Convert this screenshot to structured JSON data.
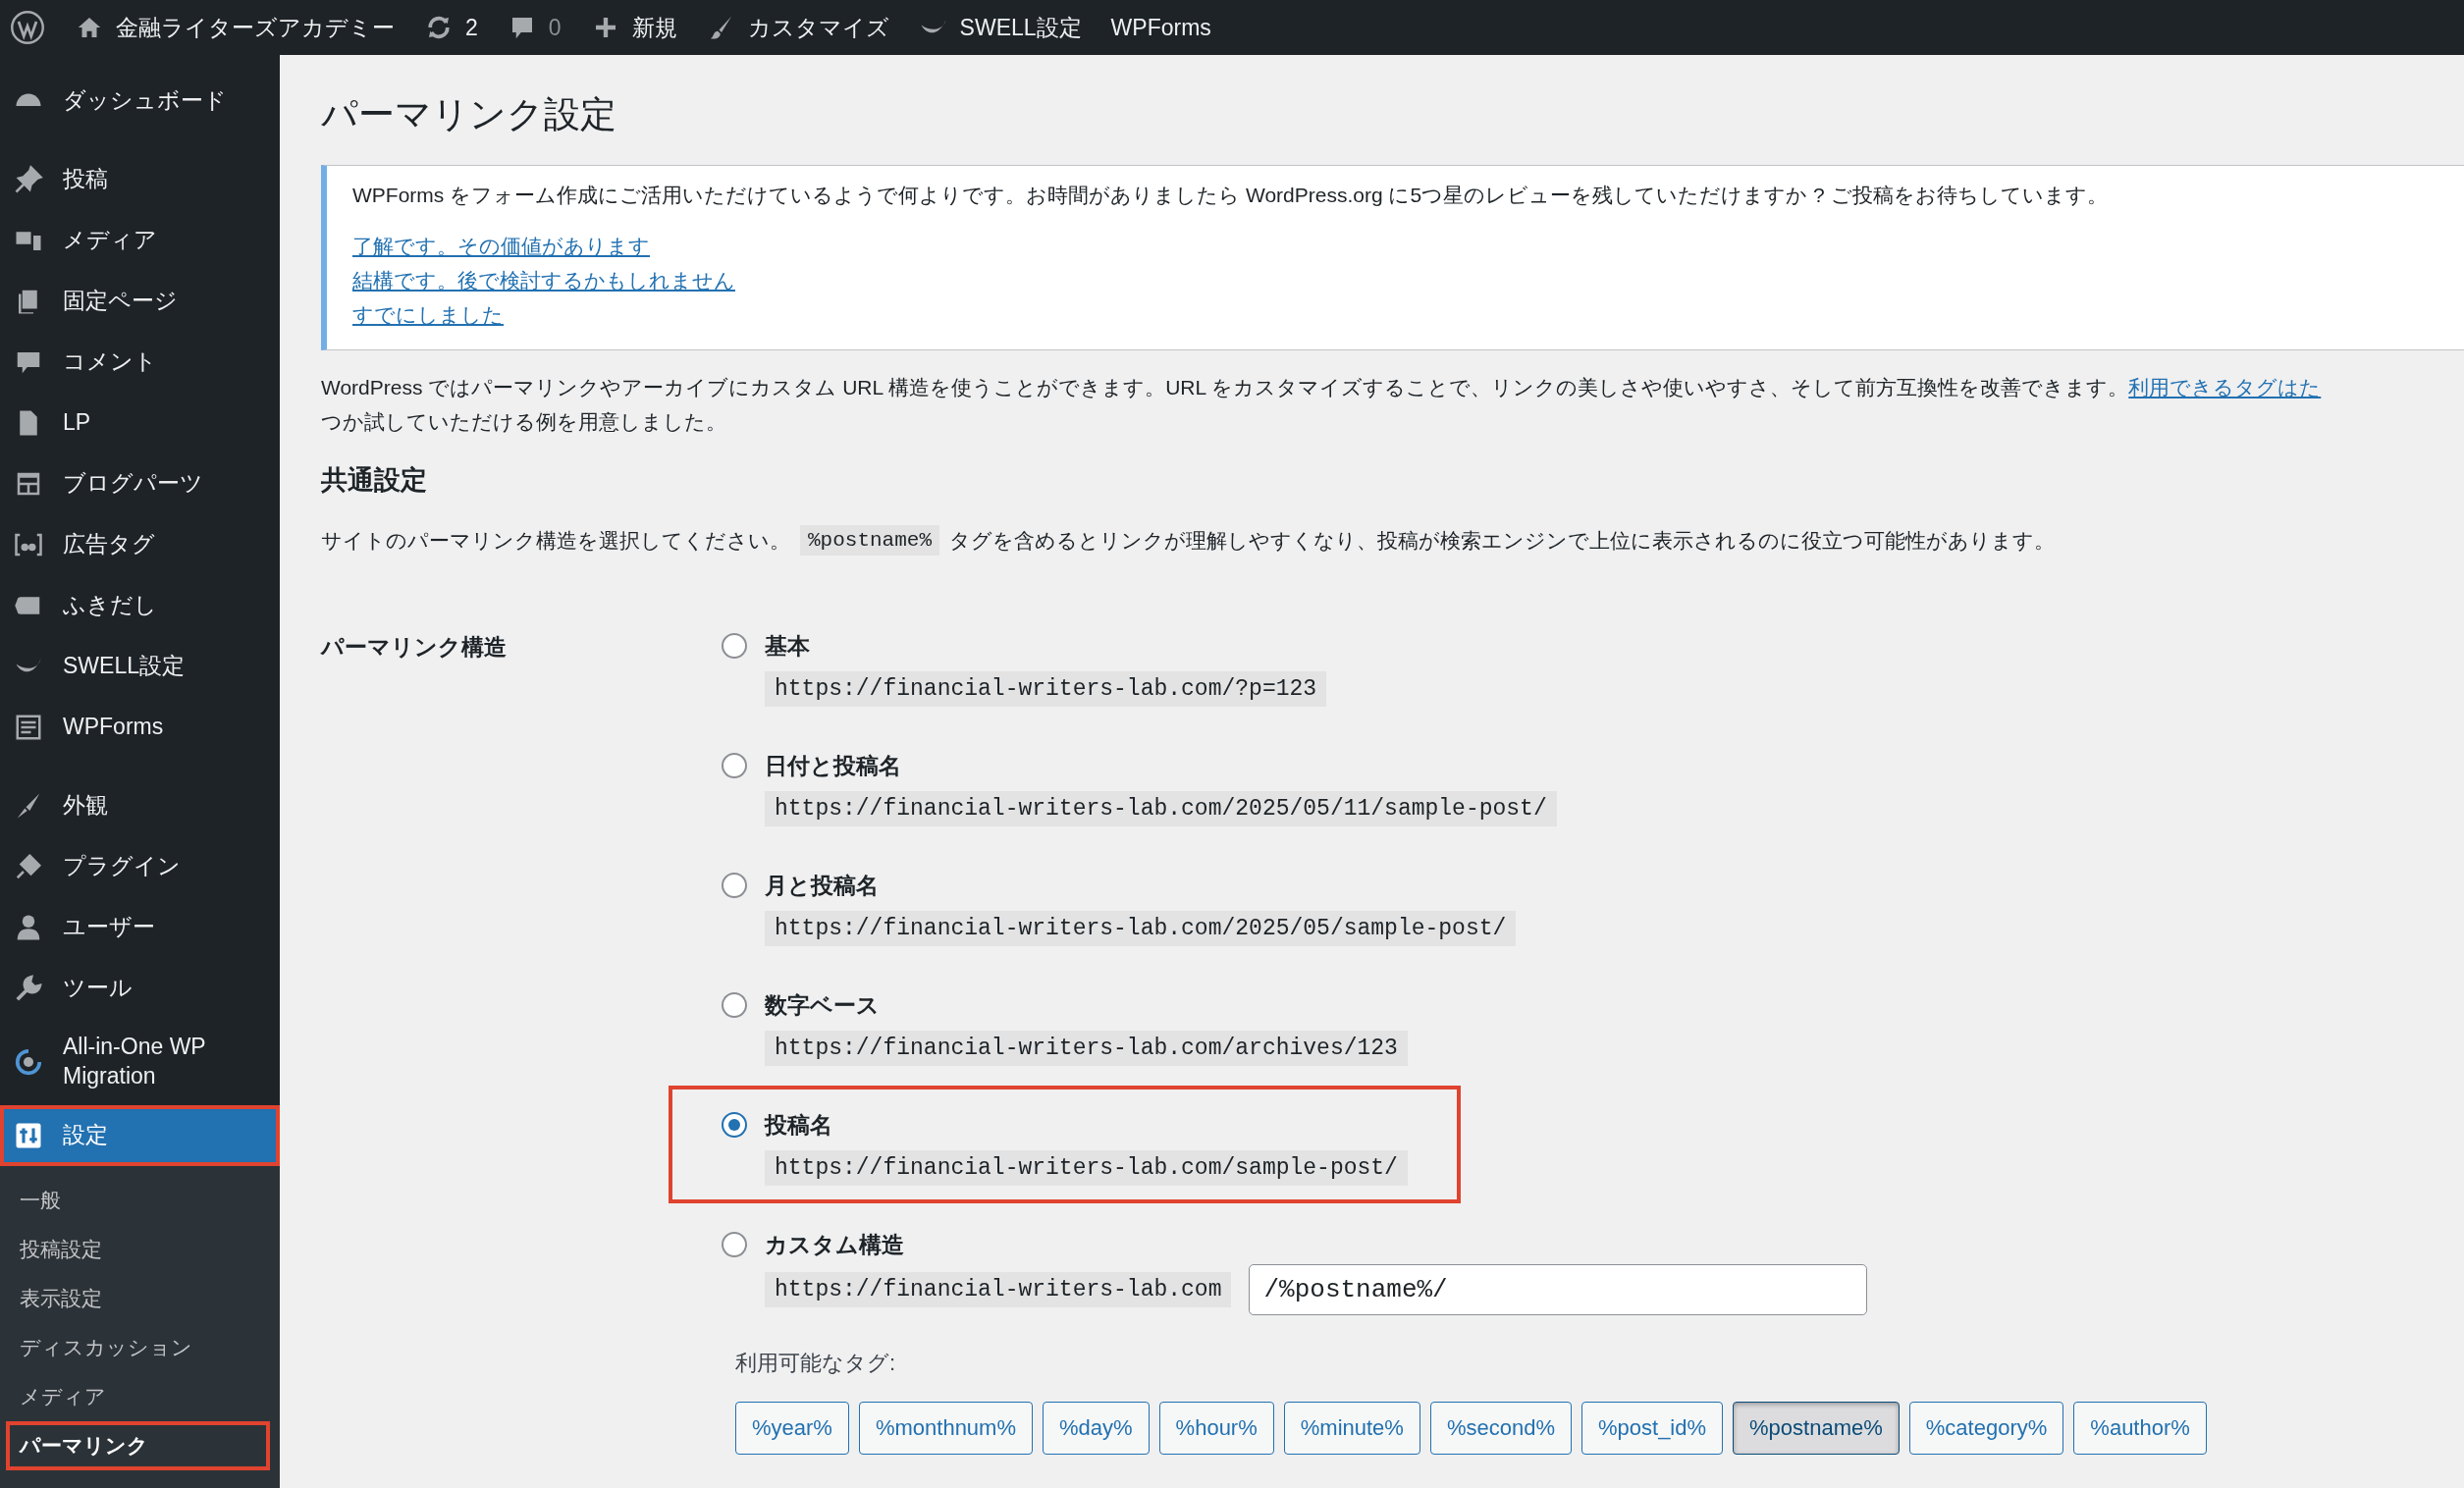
{
  "admin_bar": {
    "site_name": "金融ライターズアカデミー",
    "updates": "2",
    "comments": "0",
    "new": "新規",
    "customize": "カスタマイズ",
    "swell": "SWELL設定",
    "wpforms": "WPForms"
  },
  "sidebar": {
    "groups": [
      [
        {
          "label": "ダッシュボード",
          "selected": false,
          "highlighted": false
        }
      ],
      [
        {
          "label": "投稿",
          "selected": false,
          "highlighted": false
        },
        {
          "label": "メディア",
          "selected": false,
          "highlighted": false
        },
        {
          "label": "固定ページ",
          "selected": false,
          "highlighted": false
        },
        {
          "label": "コメント",
          "selected": false,
          "highlighted": false
        },
        {
          "label": "LP",
          "selected": false,
          "highlighted": false
        },
        {
          "label": "ブログパーツ",
          "selected": false,
          "highlighted": false
        },
        {
          "label": "広告タグ",
          "selected": false,
          "highlighted": false
        },
        {
          "label": "ふきだし",
          "selected": false,
          "highlighted": false
        },
        {
          "label": "SWELL設定",
          "selected": false,
          "highlighted": false
        },
        {
          "label": "WPForms",
          "selected": false,
          "highlighted": false
        }
      ],
      [
        {
          "label": "外観",
          "selected": false,
          "highlighted": false
        },
        {
          "label": "プラグイン",
          "selected": false,
          "highlighted": false
        },
        {
          "label": "ユーザー",
          "selected": false,
          "highlighted": false
        },
        {
          "label": "ツール",
          "selected": false,
          "highlighted": false
        },
        {
          "label": "All-in-One WP Migration",
          "selected": false,
          "highlighted": false
        },
        {
          "label": "設定",
          "selected": true,
          "highlighted": true
        }
      ]
    ],
    "submenu": [
      {
        "label": "一般",
        "selected": false,
        "highlighted": false
      },
      {
        "label": "投稿設定",
        "selected": false,
        "highlighted": false
      },
      {
        "label": "表示設定",
        "selected": false,
        "highlighted": false
      },
      {
        "label": "ディスカッション",
        "selected": false,
        "highlighted": false
      },
      {
        "label": "メディア",
        "selected": false,
        "highlighted": false
      },
      {
        "label": "パーマリンク",
        "selected": true,
        "highlighted": true
      }
    ]
  },
  "page": {
    "title": "パーマリンク設定",
    "notice": {
      "message": "WPForms をフォーム作成にご活用いただけているようで何よりです。お時間がありましたら WordPress.org に5つ星のレビューを残していただけますか ? ご投稿をお待ちしています。",
      "links": [
        "了解です。その価値があります",
        "結構です。後で検討するかもしれません",
        "すでにしました"
      ]
    },
    "intro": {
      "text": "WordPress ではパーマリンクやアーカイブにカスタム URL 構造を使うことができます。URL をカスタマイズすることで、リンクの美しさや使いやすさ、そして前方互換性を改善できます。",
      "link": "利用できるタグはた",
      "continuation": "つか試していただける例を用意しました。"
    },
    "section_title": "共通設定",
    "section_text_before": "サイトのパーマリンク構造を選択してください。",
    "section_code": "%postname%",
    "section_text_after": "タグを含めるとリンクが理解しやすくなり、投稿が検索エンジンで上位に表示されるのに役立つ可能性があります。",
    "field_label": "パーマリンク構造",
    "options": [
      {
        "kind": "preset",
        "label": "基本",
        "example": "https://financial-writers-lab.com/?p=123",
        "selected": false,
        "highlighted": false
      },
      {
        "kind": "preset",
        "label": "日付と投稿名",
        "example": "https://financial-writers-lab.com/2025/05/11/sample-post/",
        "selected": false,
        "highlighted": false
      },
      {
        "kind": "preset",
        "label": "月と投稿名",
        "example": "https://financial-writers-lab.com/2025/05/sample-post/",
        "selected": false,
        "highlighted": false
      },
      {
        "kind": "preset",
        "label": "数字ベース",
        "example": "https://financial-writers-lab.com/archives/123",
        "selected": false,
        "highlighted": false
      },
      {
        "kind": "preset",
        "label": "投稿名",
        "example": "https://financial-writers-lab.com/sample-post/",
        "selected": true,
        "highlighted": true
      },
      {
        "kind": "custom",
        "label": "カスタム構造",
        "prefix": "https://financial-writers-lab.com",
        "value": "/%postname%/",
        "selected": false,
        "highlighted": false
      }
    ],
    "tags_label": "利用可能なタグ:",
    "tags": [
      {
        "label": "%year%",
        "selected": false
      },
      {
        "label": "%monthnum%",
        "selected": false
      },
      {
        "label": "%day%",
        "selected": false
      },
      {
        "label": "%hour%",
        "selected": false
      },
      {
        "label": "%minute%",
        "selected": false
      },
      {
        "label": "%second%",
        "selected": false
      },
      {
        "label": "%post_id%",
        "selected": false
      },
      {
        "label": "%postname%",
        "selected": true
      },
      {
        "label": "%category%",
        "selected": false
      },
      {
        "label": "%author%",
        "selected": false
      }
    ]
  }
}
